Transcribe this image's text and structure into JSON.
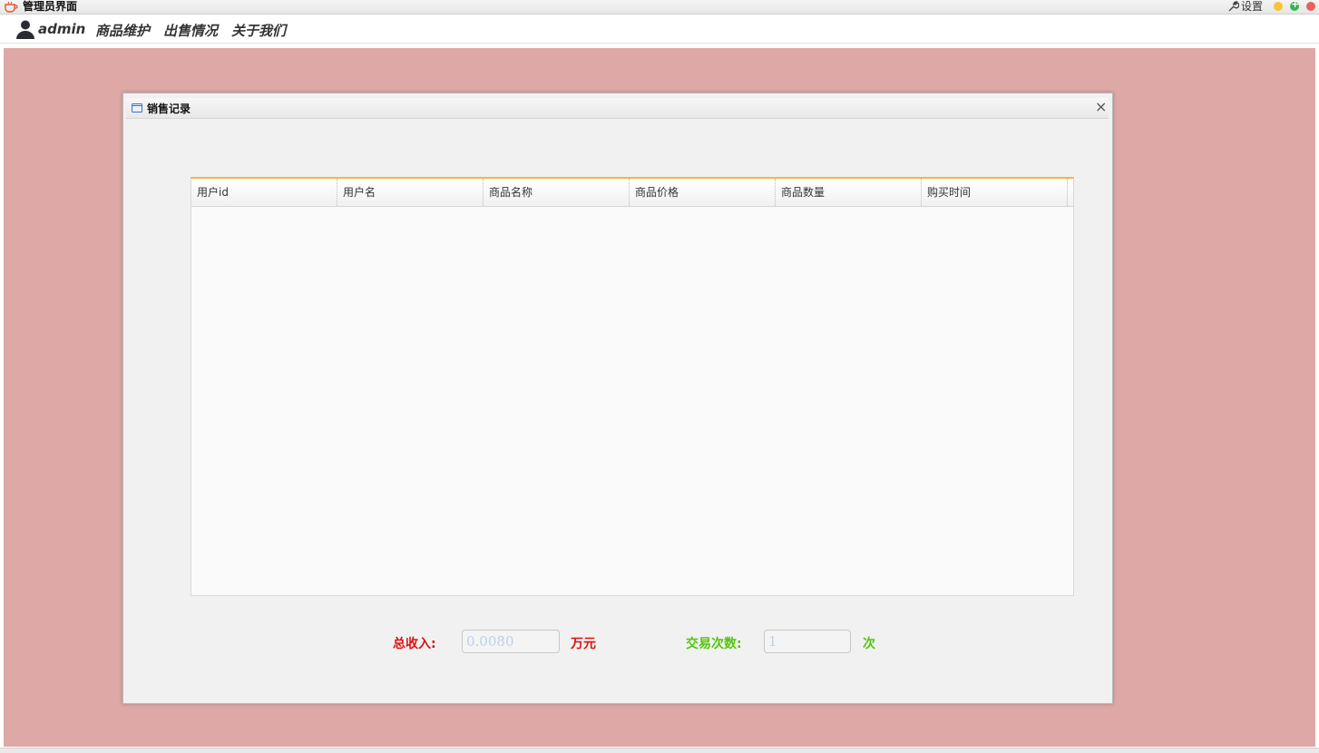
{
  "window": {
    "title": "管理员界面",
    "settings_label": "设置"
  },
  "menubar": {
    "username": "admin",
    "items": [
      {
        "label": "商品维护"
      },
      {
        "label": "出售情况"
      },
      {
        "label": "关于我们"
      }
    ]
  },
  "frame": {
    "title": "销售记录",
    "close_label": "×"
  },
  "table": {
    "columns": [
      "用户id",
      "用户名",
      "商品名称",
      "商品价格",
      "商品数量",
      "购买时间"
    ],
    "rows": []
  },
  "summary": {
    "income_label": "总收入:",
    "income_value": "0.0080",
    "income_unit": "万元",
    "count_label": "交易次数:",
    "count_value": "1",
    "count_unit": "次"
  },
  "colors": {
    "desktop": "#dea8a7",
    "income": "#dd1111",
    "count": "#55c511",
    "table_accent": "#f0b74a"
  },
  "icons": {
    "app": "coffee-cup-icon",
    "settings": "wrench-icon",
    "user": "user-silhouette-icon",
    "frame": "window-icon"
  }
}
